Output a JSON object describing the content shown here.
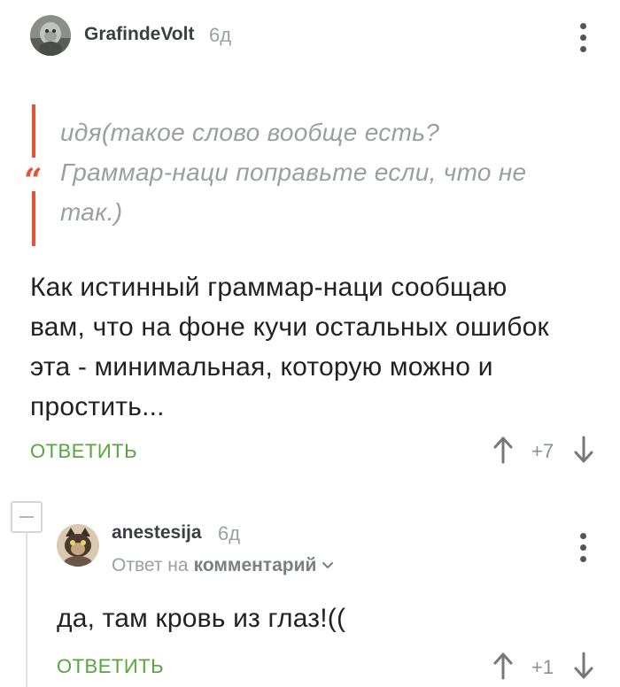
{
  "comment1": {
    "username": "GrafindeVolt",
    "time": "6д",
    "quote_lines": [
      "идя(такое слово вообще есть?",
      "Граммар-наци поправьте если, что не",
      "так.)"
    ],
    "quote_mark": "“",
    "text_lines": [
      "Как истинный граммар-наци сообщаю",
      "вам, что на фоне кучи остальных ошибок",
      "эта - минимальная, которую можно и",
      "простить..."
    ],
    "reply_label": "ОТВЕТИТЬ",
    "score": "+7"
  },
  "comment2": {
    "username": "anestesija",
    "time": "6д",
    "reply_to_prefix": "Ответ на",
    "reply_to_target": "комментарий",
    "text": "да, там кровь из глаз!((",
    "reply_label": "ОТВЕТИТЬ",
    "score": "+1"
  },
  "colors": {
    "reply_green": "#57a63b",
    "quote_accent": "#e5533d",
    "muted_gray": "#9a9fa4"
  },
  "icons": {
    "menu": "more-vertical-icon",
    "upvote": "arrow-up-icon",
    "downvote": "arrow-down-icon",
    "collapse": "minus-icon",
    "chevron": "chevron-down-icon"
  }
}
